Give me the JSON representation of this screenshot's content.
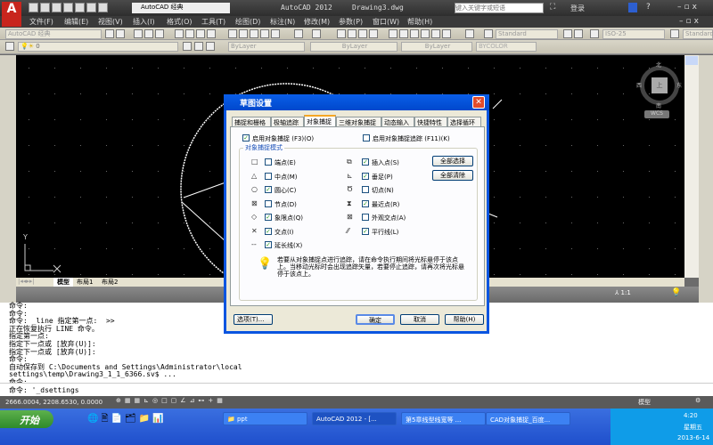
{
  "titlebar": {
    "workspace": "AutoCAD 经典",
    "title": "AutoCAD 2012",
    "file": "Drawing3.dwg",
    "search_placeholder": "键入关键字或短语",
    "login": "登录"
  },
  "menu": [
    "文件(F)",
    "编辑(E)",
    "视图(V)",
    "插入(I)",
    "格式(O)",
    "工具(T)",
    "绘图(D)",
    "标注(N)",
    "修改(M)",
    "参数(P)",
    "窗口(W)",
    "帮助(H)"
  ],
  "toolbar": {
    "workspace_combo": "AutoCAD 经典",
    "text_style": "Standard",
    "dim_style": "ISO-25",
    "table_style": "Standard",
    "layer": "0",
    "color": "ByLayer",
    "linetype": "ByLayer",
    "lineweight": "ByLayer",
    "plotstyle": "BYCOLOR"
  },
  "viewcube": {
    "north": "北",
    "south": "南",
    "east": "东",
    "west": "西",
    "top": "上",
    "wcs": "WCS"
  },
  "ucs": {
    "y": "Y",
    "x": "X"
  },
  "layout_tabs": [
    "模型",
    "布局1",
    "布局2"
  ],
  "annotation": {
    "scale": "1:1"
  },
  "command_history": [
    "命令:",
    "命令:",
    "命令: _line 指定第一点:  >>",
    "正在恢复执行 LINE 命令。",
    "指定第一点:",
    "指定下一点或 [放弃(U)]:",
    "指定下一点或 [放弃(U)]:",
    "命令:",
    "自动保存到 C:\\Documents and Settings\\Administrator\\local",
    "settings\\temp\\Drawing3_1_1_6366.sv$ ...",
    "命令:"
  ],
  "command_line": "命令: '_dsettings",
  "status": {
    "coords": "2666.0004, 2208.6530, 0.0000",
    "model": "模型"
  },
  "dialog": {
    "title": "草图设置",
    "tabs": [
      "捕捉和栅格",
      "极轴追踪",
      "对象捕捉",
      "三维对象捕捉",
      "动态输入",
      "快捷特性",
      "选择循环"
    ],
    "active_tab": 2,
    "enable_osnap": {
      "label": "启用对象捕捉 (F3)(O)",
      "checked": true
    },
    "enable_tracking": {
      "label": "启用对象捕捉追踪 (F11)(K)",
      "checked": false
    },
    "group_label": "对象捕捉模式",
    "modes_left": [
      {
        "symbol": "□",
        "label": "端点(E)",
        "checked": false
      },
      {
        "symbol": "△",
        "label": "中点(M)",
        "checked": false
      },
      {
        "symbol": "○",
        "label": "圆心(C)",
        "checked": true
      },
      {
        "symbol": "⊠",
        "label": "节点(D)",
        "checked": false
      },
      {
        "symbol": "◇",
        "label": "象限点(Q)",
        "checked": true
      },
      {
        "symbol": "✕",
        "label": "交点(I)",
        "checked": true
      },
      {
        "symbol": "--",
        "label": "延长线(X)",
        "checked": true
      }
    ],
    "modes_right": [
      {
        "symbol": "⧉",
        "label": "插入点(S)",
        "checked": true
      },
      {
        "symbol": "⊾",
        "label": "垂足(P)",
        "checked": true
      },
      {
        "symbol": "Ծ",
        "label": "切点(N)",
        "checked": false
      },
      {
        "symbol": "⧗",
        "label": "最近点(R)",
        "checked": true
      },
      {
        "symbol": "⊠",
        "label": "外观交点(A)",
        "checked": false
      },
      {
        "symbol": "⁄⁄",
        "label": "平行线(L)",
        "checked": true
      }
    ],
    "select_all": "全部选择",
    "clear_all": "全部清除",
    "hint": "若要从对象捕捉点进行追踪，请在命令执行期间将光标悬停于该点上。当移动光标时会出现追踪矢量，若要停止追踪，请再次将光标悬停于该点上。",
    "options": "选项(T)...",
    "ok": "确定",
    "cancel": "取消",
    "help": "帮助(H)"
  },
  "taskbar": {
    "start": "开始",
    "tasks": [
      "ppt",
      "AutoCAD 2012 - [...",
      "第5章线型线宽等 ...",
      "CAD对象捕捉_百度..."
    ],
    "time": "4:20",
    "weekday": "星期五",
    "date": "2013-6-14"
  }
}
